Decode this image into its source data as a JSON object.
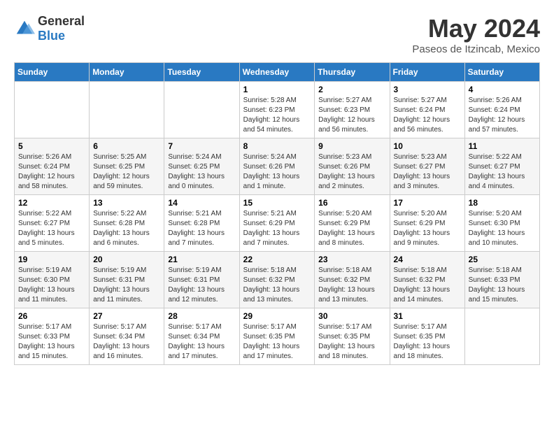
{
  "header": {
    "logo": {
      "general": "General",
      "blue": "Blue"
    },
    "title": "May 2024",
    "location": "Paseos de Itzincab, Mexico"
  },
  "calendar": {
    "weekdays": [
      "Sunday",
      "Monday",
      "Tuesday",
      "Wednesday",
      "Thursday",
      "Friday",
      "Saturday"
    ],
    "weeks": [
      [
        {
          "day": "",
          "info": ""
        },
        {
          "day": "",
          "info": ""
        },
        {
          "day": "",
          "info": ""
        },
        {
          "day": "1",
          "info": "Sunrise: 5:28 AM\nSunset: 6:23 PM\nDaylight: 12 hours\nand 54 minutes."
        },
        {
          "day": "2",
          "info": "Sunrise: 5:27 AM\nSunset: 6:23 PM\nDaylight: 12 hours\nand 56 minutes."
        },
        {
          "day": "3",
          "info": "Sunrise: 5:27 AM\nSunset: 6:24 PM\nDaylight: 12 hours\nand 56 minutes."
        },
        {
          "day": "4",
          "info": "Sunrise: 5:26 AM\nSunset: 6:24 PM\nDaylight: 12 hours\nand 57 minutes."
        }
      ],
      [
        {
          "day": "5",
          "info": "Sunrise: 5:26 AM\nSunset: 6:24 PM\nDaylight: 12 hours\nand 58 minutes."
        },
        {
          "day": "6",
          "info": "Sunrise: 5:25 AM\nSunset: 6:25 PM\nDaylight: 12 hours\nand 59 minutes."
        },
        {
          "day": "7",
          "info": "Sunrise: 5:24 AM\nSunset: 6:25 PM\nDaylight: 13 hours\nand 0 minutes."
        },
        {
          "day": "8",
          "info": "Sunrise: 5:24 AM\nSunset: 6:26 PM\nDaylight: 13 hours\nand 1 minute."
        },
        {
          "day": "9",
          "info": "Sunrise: 5:23 AM\nSunset: 6:26 PM\nDaylight: 13 hours\nand 2 minutes."
        },
        {
          "day": "10",
          "info": "Sunrise: 5:23 AM\nSunset: 6:27 PM\nDaylight: 13 hours\nand 3 minutes."
        },
        {
          "day": "11",
          "info": "Sunrise: 5:22 AM\nSunset: 6:27 PM\nDaylight: 13 hours\nand 4 minutes."
        }
      ],
      [
        {
          "day": "12",
          "info": "Sunrise: 5:22 AM\nSunset: 6:27 PM\nDaylight: 13 hours\nand 5 minutes."
        },
        {
          "day": "13",
          "info": "Sunrise: 5:22 AM\nSunset: 6:28 PM\nDaylight: 13 hours\nand 6 minutes."
        },
        {
          "day": "14",
          "info": "Sunrise: 5:21 AM\nSunset: 6:28 PM\nDaylight: 13 hours\nand 7 minutes."
        },
        {
          "day": "15",
          "info": "Sunrise: 5:21 AM\nSunset: 6:29 PM\nDaylight: 13 hours\nand 7 minutes."
        },
        {
          "day": "16",
          "info": "Sunrise: 5:20 AM\nSunset: 6:29 PM\nDaylight: 13 hours\nand 8 minutes."
        },
        {
          "day": "17",
          "info": "Sunrise: 5:20 AM\nSunset: 6:29 PM\nDaylight: 13 hours\nand 9 minutes."
        },
        {
          "day": "18",
          "info": "Sunrise: 5:20 AM\nSunset: 6:30 PM\nDaylight: 13 hours\nand 10 minutes."
        }
      ],
      [
        {
          "day": "19",
          "info": "Sunrise: 5:19 AM\nSunset: 6:30 PM\nDaylight: 13 hours\nand 11 minutes."
        },
        {
          "day": "20",
          "info": "Sunrise: 5:19 AM\nSunset: 6:31 PM\nDaylight: 13 hours\nand 11 minutes."
        },
        {
          "day": "21",
          "info": "Sunrise: 5:19 AM\nSunset: 6:31 PM\nDaylight: 13 hours\nand 12 minutes."
        },
        {
          "day": "22",
          "info": "Sunrise: 5:18 AM\nSunset: 6:32 PM\nDaylight: 13 hours\nand 13 minutes."
        },
        {
          "day": "23",
          "info": "Sunrise: 5:18 AM\nSunset: 6:32 PM\nDaylight: 13 hours\nand 13 minutes."
        },
        {
          "day": "24",
          "info": "Sunrise: 5:18 AM\nSunset: 6:32 PM\nDaylight: 13 hours\nand 14 minutes."
        },
        {
          "day": "25",
          "info": "Sunrise: 5:18 AM\nSunset: 6:33 PM\nDaylight: 13 hours\nand 15 minutes."
        }
      ],
      [
        {
          "day": "26",
          "info": "Sunrise: 5:17 AM\nSunset: 6:33 PM\nDaylight: 13 hours\nand 15 minutes."
        },
        {
          "day": "27",
          "info": "Sunrise: 5:17 AM\nSunset: 6:34 PM\nDaylight: 13 hours\nand 16 minutes."
        },
        {
          "day": "28",
          "info": "Sunrise: 5:17 AM\nSunset: 6:34 PM\nDaylight: 13 hours\nand 17 minutes."
        },
        {
          "day": "29",
          "info": "Sunrise: 5:17 AM\nSunset: 6:35 PM\nDaylight: 13 hours\nand 17 minutes."
        },
        {
          "day": "30",
          "info": "Sunrise: 5:17 AM\nSunset: 6:35 PM\nDaylight: 13 hours\nand 18 minutes."
        },
        {
          "day": "31",
          "info": "Sunrise: 5:17 AM\nSunset: 6:35 PM\nDaylight: 13 hours\nand 18 minutes."
        },
        {
          "day": "",
          "info": ""
        }
      ]
    ]
  }
}
